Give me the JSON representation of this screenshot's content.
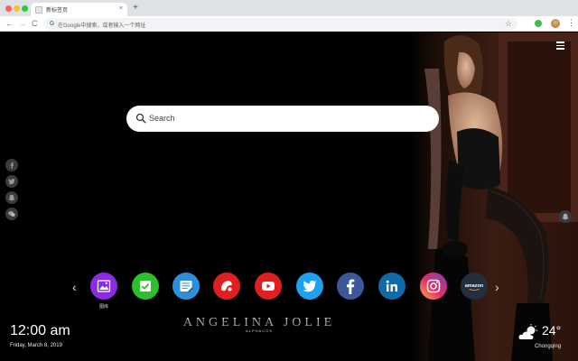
{
  "browser": {
    "tab_title": "新标签页",
    "tab_close": "×",
    "new_tab": "+",
    "omnibox_placeholder": "在Google中搜索，或者输入一个网址",
    "google_glyph": "G",
    "bookmark_star": "☆",
    "nav_back": "←",
    "nav_forward": "→",
    "nav_reload": "C",
    "menu": "⋮"
  },
  "search": {
    "placeholder": "Search"
  },
  "social_links": [
    {
      "name": "facebook-icon"
    },
    {
      "name": "twitter-icon"
    },
    {
      "name": "snapchat-icon"
    },
    {
      "name": "wechat-icon"
    }
  ],
  "dock": {
    "prev": "‹",
    "next": "›",
    "apps": [
      {
        "name": "gallery",
        "label": "图库",
        "color": "#8b2be2"
      },
      {
        "name": "tasks",
        "label": "",
        "color": "#2dbf2d"
      },
      {
        "name": "notes",
        "label": "",
        "color": "#2d8fd8"
      },
      {
        "name": "game",
        "label": "",
        "color": "#e02020"
      },
      {
        "name": "youtube",
        "label": "",
        "color": "#e02020"
      },
      {
        "name": "twitter",
        "label": "",
        "color": "#1da1f2"
      },
      {
        "name": "facebook",
        "label": "",
        "color": "#3b5998"
      },
      {
        "name": "linkedin",
        "label": "",
        "color": "#0e6aa8"
      },
      {
        "name": "instagram",
        "label": "",
        "color": "#d6249f"
      },
      {
        "name": "amazon",
        "label": "amazon",
        "color": "#232f3e"
      }
    ]
  },
  "brand": {
    "title": "ANGELINA JOLIE",
    "subtitle": "ALPHACOS"
  },
  "clock": {
    "time": "12:00 am",
    "date": "Friday, March 8, 2019"
  },
  "weather": {
    "temperature": "24°",
    "city": "Chongqing"
  }
}
